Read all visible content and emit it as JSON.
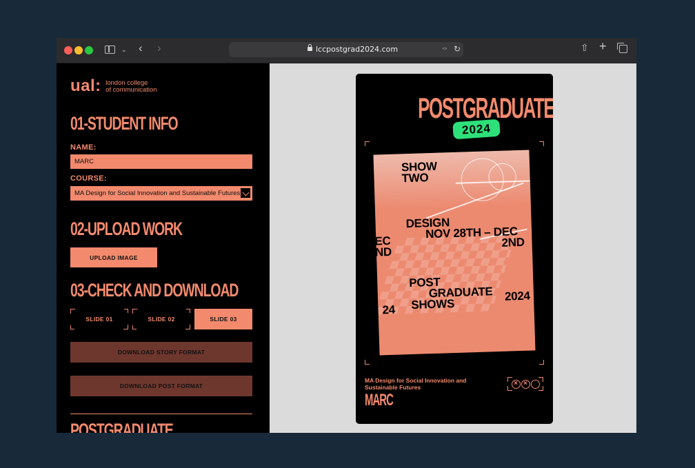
{
  "browser": {
    "url": "lccpostgrad2024.com"
  },
  "sidebar": {
    "logo": {
      "mark": "ual:",
      "name_line1": "london college",
      "name_line2": "of communication"
    },
    "section1": {
      "title": "01-STUDENT INFO",
      "name_label": "NAME:",
      "name_value": "MARC",
      "course_label": "COURSE:",
      "course_value": "MA Design for Social Innovation and Sustainable Futures"
    },
    "section2": {
      "title": "02-UPLOAD WORK",
      "upload_button": "UPLOAD IMAGE"
    },
    "section3": {
      "title": "03-CHECK AND DOWNLOAD",
      "slides": [
        "SLIDE 01",
        "SLIDE 02",
        "SLIDE 03"
      ],
      "active_slide": "SLIDE 03",
      "download_story": "DOWNLOAD STORY FORMAT",
      "download_post": "DOWNLOAD POST FORMAT"
    },
    "footer_heading": "POSTGRADUATE"
  },
  "preview": {
    "title": "POSTGRADUATE SHOWS",
    "badge": "2024",
    "artwork": {
      "show": "SHOW\nTWO",
      "design": "DESIGN",
      "dates": "NOV 28TH – DEC",
      "dates_right": "2ND",
      "left_edge_1": "EC",
      "left_edge_2": "ND",
      "post": "POST",
      "graduate": "GRADUATE",
      "shows": "SHOWS",
      "year_right": "2024",
      "year_left": "24"
    },
    "course_caption": "MA Design for Social Innovation and Sustainable Futures",
    "name_caption": "MARC"
  },
  "colors": {
    "accent": "#f38a6d",
    "badge_green": "#2ee07a",
    "download_button": "#6e372d"
  }
}
